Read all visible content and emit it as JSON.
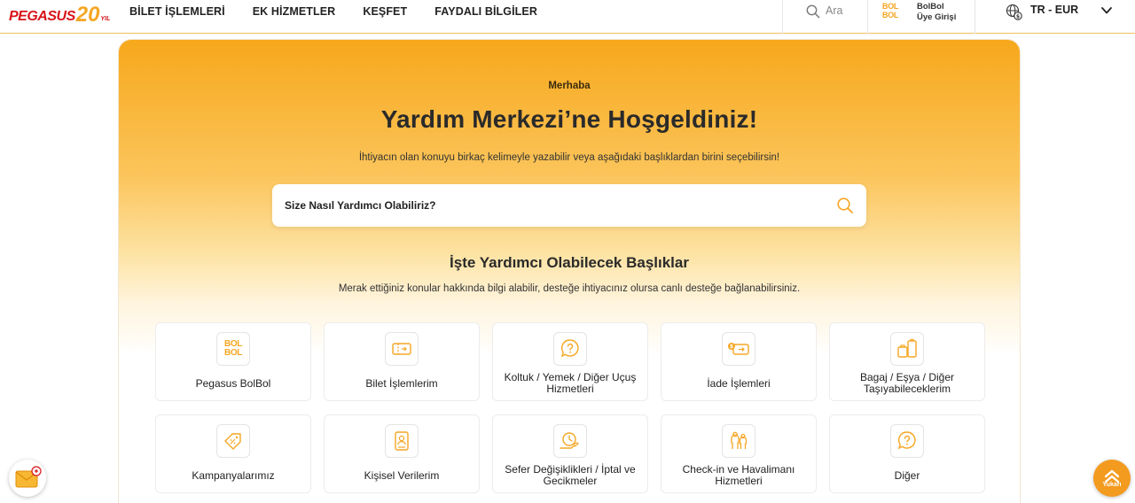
{
  "header": {
    "logo": {
      "brand": "PEGASUS",
      "number": "20",
      "suffix": "YIL"
    },
    "nav": [
      "BİLET İŞLEMLERİ",
      "EK HİZMETLER",
      "KEŞFET",
      "FAYDALI BİLGİLER"
    ],
    "search_label": "Ara",
    "bolbol_logo_top": "BOL",
    "bolbol_logo_bottom": "BOL",
    "bolbol_line1": "BolBol",
    "bolbol_line2": "Üye Girişi",
    "language": "TR - EUR"
  },
  "hero": {
    "hello": "Merhaba",
    "title": "Yardım Merkezi’ne Hoşgeldiniz!",
    "subtitle": "İhtiyacın olan konuyu birkaç kelimeyle yazabilir veya aşağıdaki başlıklardan birini seçebilirsin!",
    "search_placeholder": "Size Nasıl Yardımcı Olabiliriz?"
  },
  "topics": {
    "title": "İşte Yardımcı Olabilecek Başlıklar",
    "subtitle": "Merak ettiğiniz konular hakkında bilgi alabilir, desteğe ihtiyacınız olursa canlı desteğe bağlanabilirsiniz.",
    "items": [
      {
        "label": "Pegasus BolBol",
        "icon": "bolbol-icon",
        "logo_top": "BOL",
        "logo_bottom": "BOL"
      },
      {
        "label": "Bilet İşlemlerim",
        "icon": "ticket-icon"
      },
      {
        "label": "Koltuk / Yemek / Diğer Uçuş Hizmetleri",
        "icon": "question-bubble-icon"
      },
      {
        "label": "İade İşlemleri",
        "icon": "refund-ticket-icon"
      },
      {
        "label": "Bagaj / Eşya / Diğer Taşıyabileceklerim",
        "icon": "luggage-icon"
      },
      {
        "label": "Kampanyalarımız",
        "icon": "discount-tag-icon"
      },
      {
        "label": "Kişisel Verilerim",
        "icon": "id-card-icon"
      },
      {
        "label": "Sefer Değişiklikleri / İptal ve Gecikmeler",
        "icon": "schedule-change-icon"
      },
      {
        "label": "Check-in ve Havalimanı Hizmetleri",
        "icon": "passengers-icon"
      },
      {
        "label": "Diğer",
        "icon": "question-bubble-icon"
      }
    ]
  },
  "fab": {
    "top_label": "Yukarı"
  },
  "colors": {
    "accent": "#f5a623",
    "brand_red": "#d7141a",
    "hero_top": "#f7a81b"
  }
}
